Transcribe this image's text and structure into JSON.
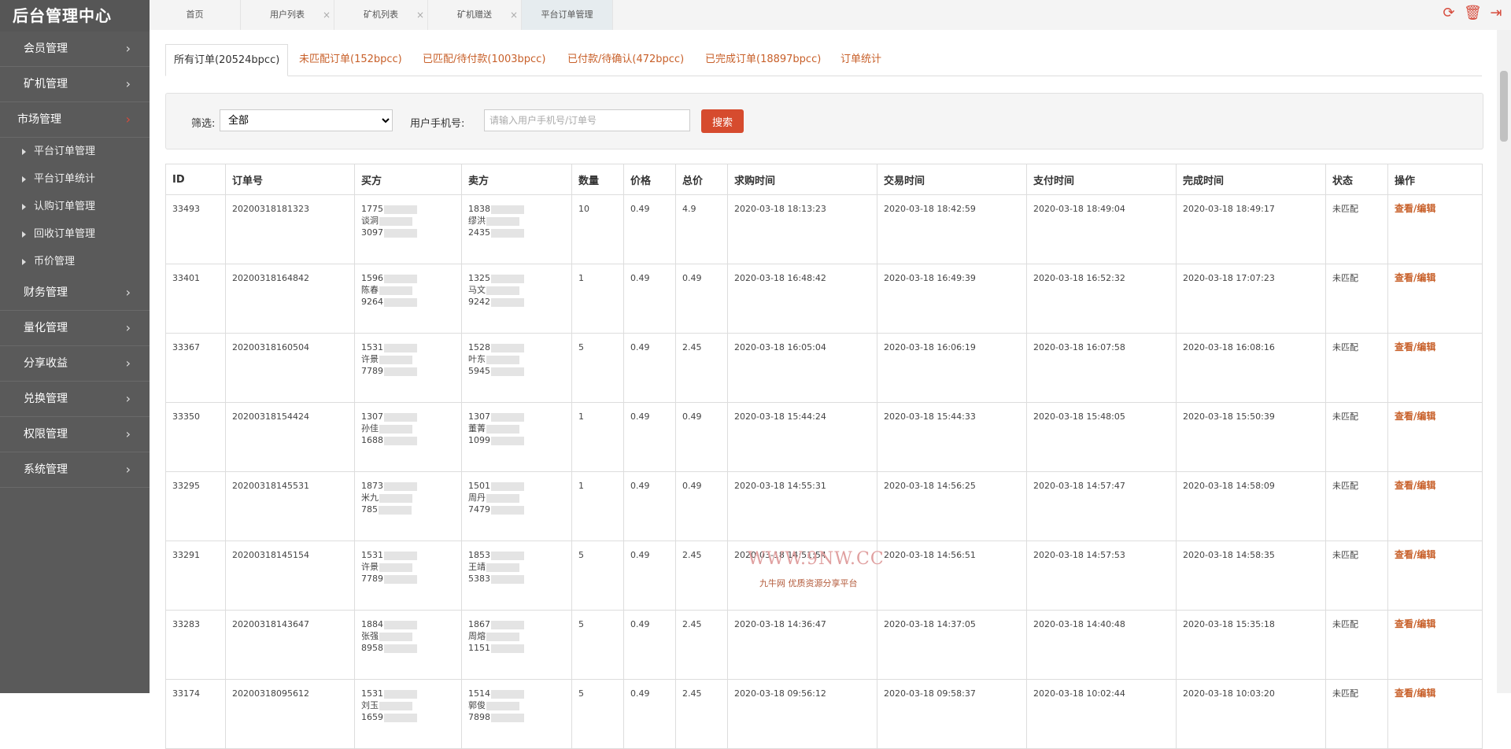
{
  "brand": "后台管理中心",
  "sidebar": {
    "items": [
      {
        "label": "会员管理"
      },
      {
        "label": "矿机管理"
      },
      {
        "label": "市场管理"
      },
      {
        "label": "财务管理"
      },
      {
        "label": "量化管理"
      },
      {
        "label": "分享收益"
      },
      {
        "label": "兑换管理"
      },
      {
        "label": "权限管理"
      },
      {
        "label": "系统管理"
      }
    ],
    "subitems": [
      {
        "label": "平台订单管理"
      },
      {
        "label": "平台订单统计"
      },
      {
        "label": "认购订单管理"
      },
      {
        "label": "回收订单管理"
      },
      {
        "label": "币价管理"
      }
    ]
  },
  "topbar": {
    "tabs": [
      {
        "label": "首页"
      },
      {
        "label": "用户列表"
      },
      {
        "label": "矿机列表"
      },
      {
        "label": "矿机赠送"
      },
      {
        "label": "平台订单管理"
      }
    ]
  },
  "order_tabs": [
    {
      "label": "所有订单(20524bpcc)"
    },
    {
      "label": "未匹配订单(152bpcc)"
    },
    {
      "label": "已匹配/待付款(1003bpcc)"
    },
    {
      "label": "已付款/待确认(472bpcc)"
    },
    {
      "label": "已完成订单(18897bpcc)"
    },
    {
      "label": "订单统计"
    }
  ],
  "filter": {
    "label": "筛选:",
    "selected": "全部",
    "phone_label": "用户手机号:",
    "phone_placeholder": "请输入用户手机号/订单号",
    "search_label": "搜索"
  },
  "table": {
    "headers": [
      "ID",
      "订单号",
      "买方",
      "卖方",
      "数量",
      "价格",
      "总价",
      "求购时间",
      "交易时间",
      "支付时间",
      "完成时间",
      "状态",
      "操作"
    ],
    "rows": [
      {
        "id": "33493",
        "order_no": "20200318181323",
        "buyer": [
          "1775",
          "谈洞",
          "3097"
        ],
        "seller": [
          "1838",
          "缪洪",
          "2435"
        ],
        "qty": "10",
        "price": "0.49",
        "total": "4.9",
        "request_time": "2020-03-18 18:13:23",
        "trade_time": "2020-03-18 18:42:59",
        "pay_time": "2020-03-18 18:49:04",
        "done_time": "2020-03-18 18:49:17",
        "status": "未匹配",
        "action": "查看/编辑"
      },
      {
        "id": "33401",
        "order_no": "20200318164842",
        "buyer": [
          "1596",
          "陈春",
          "9264"
        ],
        "seller": [
          "1325",
          "马文",
          "9242"
        ],
        "qty": "1",
        "price": "0.49",
        "total": "0.49",
        "request_time": "2020-03-18 16:48:42",
        "trade_time": "2020-03-18 16:49:39",
        "pay_time": "2020-03-18 16:52:32",
        "done_time": "2020-03-18 17:07:23",
        "status": "未匹配",
        "action": "查看/编辑"
      },
      {
        "id": "33367",
        "order_no": "20200318160504",
        "buyer": [
          "1531",
          "许景",
          "7789"
        ],
        "seller": [
          "1528",
          "叶东",
          "5945"
        ],
        "qty": "5",
        "price": "0.49",
        "total": "2.45",
        "request_time": "2020-03-18 16:05:04",
        "trade_time": "2020-03-18 16:06:19",
        "pay_time": "2020-03-18 16:07:58",
        "done_time": "2020-03-18 16:08:16",
        "status": "未匹配",
        "action": "查看/编辑"
      },
      {
        "id": "33350",
        "order_no": "20200318154424",
        "buyer": [
          "1307",
          "孙佳",
          "1688"
        ],
        "seller": [
          "1307",
          "董菁",
          "1099"
        ],
        "qty": "1",
        "price": "0.49",
        "total": "0.49",
        "request_time": "2020-03-18 15:44:24",
        "trade_time": "2020-03-18 15:44:33",
        "pay_time": "2020-03-18 15:48:05",
        "done_time": "2020-03-18 15:50:39",
        "status": "未匹配",
        "action": "查看/编辑"
      },
      {
        "id": "33295",
        "order_no": "20200318145531",
        "buyer": [
          "1873",
          "米九",
          "785"
        ],
        "seller": [
          "1501",
          "周丹",
          "7479"
        ],
        "qty": "1",
        "price": "0.49",
        "total": "0.49",
        "request_time": "2020-03-18 14:55:31",
        "trade_time": "2020-03-18 14:56:25",
        "pay_time": "2020-03-18 14:57:47",
        "done_time": "2020-03-18 14:58:09",
        "status": "未匹配",
        "action": "查看/编辑"
      },
      {
        "id": "33291",
        "order_no": "20200318145154",
        "buyer": [
          "1531",
          "许景",
          "7789"
        ],
        "seller": [
          "1853",
          "王靖",
          "5383"
        ],
        "qty": "5",
        "price": "0.49",
        "total": "2.45",
        "request_time": "2020-03-18 14:51:54",
        "trade_time": "2020-03-18 14:56:51",
        "pay_time": "2020-03-18 14:57:53",
        "done_time": "2020-03-18 14:58:35",
        "status": "未匹配",
        "action": "查看/编辑"
      },
      {
        "id": "33283",
        "order_no": "20200318143647",
        "buyer": [
          "1884",
          "张强",
          "8958"
        ],
        "seller": [
          "1867",
          "周熔",
          "1151"
        ],
        "qty": "5",
        "price": "0.49",
        "total": "2.45",
        "request_time": "2020-03-18 14:36:47",
        "trade_time": "2020-03-18 14:37:05",
        "pay_time": "2020-03-18 14:40:48",
        "done_time": "2020-03-18 15:35:18",
        "status": "未匹配",
        "action": "查看/编辑"
      },
      {
        "id": "33174",
        "order_no": "20200318095612",
        "buyer": [
          "1531",
          "刘玉",
          "1659"
        ],
        "seller": [
          "1514",
          "郭俊",
          "7898"
        ],
        "qty": "5",
        "price": "0.49",
        "total": "2.45",
        "request_time": "2020-03-18 09:56:12",
        "trade_time": "2020-03-18 09:58:37",
        "pay_time": "2020-03-18 10:02:44",
        "done_time": "2020-03-18 10:03:20",
        "status": "未匹配",
        "action": "查看/编辑"
      }
    ]
  },
  "watermark": {
    "line1": "WWW.9NW.CC",
    "line2": "九牛网 优质资源分享平台"
  }
}
